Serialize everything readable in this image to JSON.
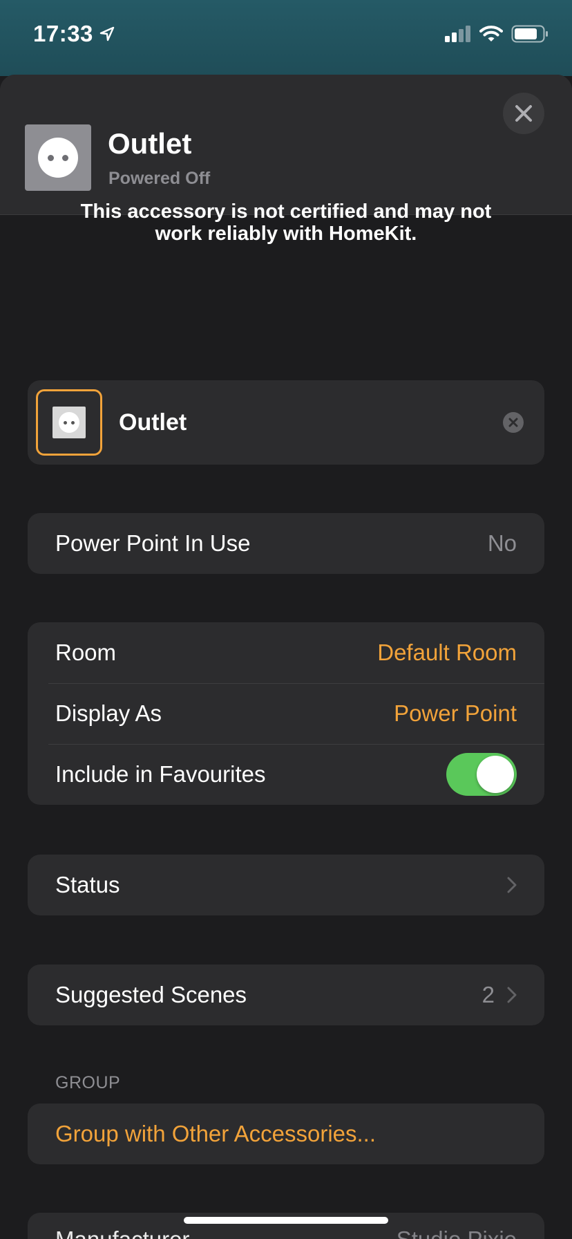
{
  "status_bar": {
    "time": "17:33"
  },
  "header": {
    "title": "Outlet",
    "subtitle": "Powered Off"
  },
  "notice": "This accessory is not certified and may not work reliably with HomeKit.",
  "accessory_name": {
    "value": "Outlet"
  },
  "power_group": {
    "label": "Power Point In Use",
    "value": "No"
  },
  "settings_group": {
    "room": {
      "label": "Room",
      "value": "Default Room"
    },
    "display_as": {
      "label": "Display As",
      "value": "Power Point"
    },
    "favourites": {
      "label": "Include in Favourites",
      "enabled": true
    }
  },
  "status_row": {
    "label": "Status"
  },
  "scenes_row": {
    "label": "Suggested Scenes",
    "count": "2"
  },
  "group_section": {
    "header": "GROUP",
    "action": "Group with Other Accessories..."
  },
  "manufacturer_row": {
    "label": "Manufacturer",
    "value": "Studio Pixie"
  },
  "colors": {
    "accent": "#f2a33a",
    "toggle_on": "#5ac85a",
    "background": "#1c1c1e",
    "cell": "#2c2c2e"
  }
}
